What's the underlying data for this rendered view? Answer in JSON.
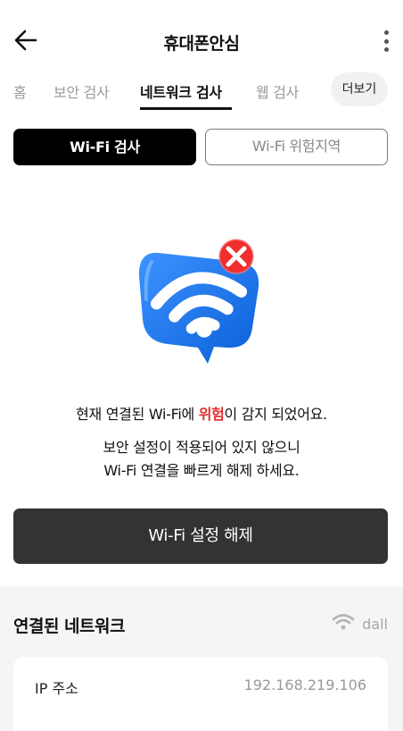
{
  "header": {
    "title": "휴대폰안심"
  },
  "tabs": [
    {
      "label": "홈"
    },
    {
      "label": "보안 검사"
    },
    {
      "label": "네트워크 검사"
    },
    {
      "label": "웹 검사"
    }
  ],
  "more_label": "더보기",
  "segments": {
    "primary": "Wi-Fi 검사",
    "secondary": "Wi-Fi 위험지역"
  },
  "message": {
    "line1_prefix": "현재 연결된 Wi-Fi에 ",
    "line1_danger": "위험",
    "line1_suffix": "이 감지 되었어요.",
    "line2": "보안 설정이 적용되어 있지 않으니",
    "line3": "Wi-Fi 연결을 빠르게 해제 하세요."
  },
  "action_button": "Wi-Fi 설정 해제",
  "network_section": {
    "title": "연결된 네트워크",
    "network_name": "dall",
    "ip_label": "IP 주소",
    "ip_value": "192.168.219.106"
  },
  "colors": {
    "danger": "#e52b2b",
    "primary_button": "#000000",
    "action_button": "#333333",
    "bubble_blue": "#1f7cf0"
  },
  "icons": {
    "back": "arrow-left-icon",
    "menu": "kebab-menu-icon",
    "wifi": "wifi-icon",
    "alert": "error-x-icon"
  }
}
